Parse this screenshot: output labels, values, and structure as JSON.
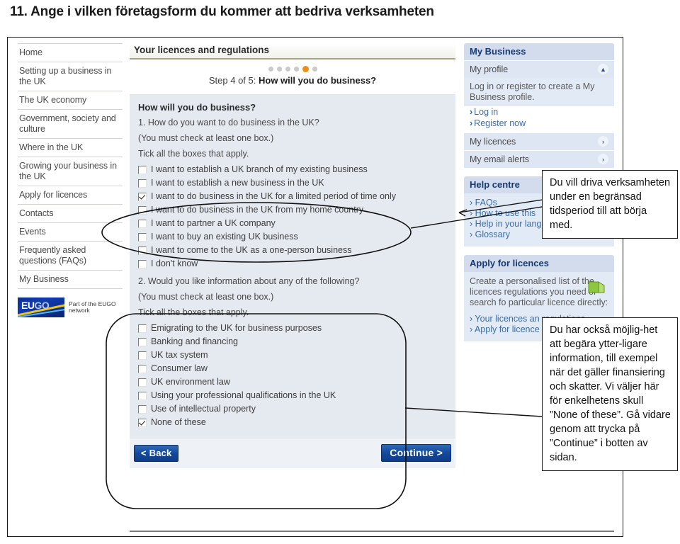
{
  "slide": {
    "heading": "11. Ange i vilken företagsform du kommer att bedriva verksamheten"
  },
  "sidebar": {
    "items": [
      {
        "label": "Home"
      },
      {
        "label": "Setting up a business in the UK"
      },
      {
        "label": "The UK economy"
      },
      {
        "label": "Government, society and culture"
      },
      {
        "label": "Where in the UK"
      },
      {
        "label": "Growing your business in the UK"
      },
      {
        "label": "Apply for licences"
      },
      {
        "label": "Contacts"
      },
      {
        "label": "Events"
      },
      {
        "label": "Frequently asked questions (FAQs)"
      },
      {
        "label": "My Business"
      }
    ],
    "logo": {
      "badge_eu": "EU",
      "badge_go": "GO",
      "tagline": "Part of\nthe EUGO\nnetwork"
    }
  },
  "main": {
    "title": "Your licences and regulations",
    "step": {
      "prefix": "Step 4 of 5: ",
      "title": "How will you do business?",
      "dots_total": 6,
      "active_dot": 5,
      "active_color": "#f28c14",
      "inactive_color": "#c9c9c9"
    },
    "form": {
      "heading": "How will you do business?",
      "q1": {
        "question": "1. How do you want to do business in the UK?",
        "requirement": "(You must check at least one box.)",
        "instruction": "Tick all the boxes that apply.",
        "options": [
          {
            "label": "I want to establish a UK branch of my existing business",
            "checked": false
          },
          {
            "label": "I want to establish a new business in the UK",
            "checked": false
          },
          {
            "label": "I want to do business in the UK for a limited period of time only",
            "checked": true
          },
          {
            "label": "I want to do business in the UK from my home country",
            "checked": false
          },
          {
            "label": "I want to partner a UK company",
            "checked": false
          },
          {
            "label": "I want to buy an existing UK business",
            "checked": false
          },
          {
            "label": "I want to come to the UK as a one-person business",
            "checked": false
          },
          {
            "label": "I don't know",
            "checked": false
          }
        ]
      },
      "q2": {
        "question": "2. Would you like information about any of the following?",
        "requirement": "(You must check at least one box.)",
        "instruction": "Tick all the boxes that apply.",
        "options": [
          {
            "label": "Emigrating to the UK for business purposes",
            "checked": false
          },
          {
            "label": "Banking and financing",
            "checked": false
          },
          {
            "label": "UK tax system",
            "checked": false
          },
          {
            "label": "Consumer law",
            "checked": false
          },
          {
            "label": "UK environment law",
            "checked": false
          },
          {
            "label": "Using your professional qualifications in the UK",
            "checked": false
          },
          {
            "label": "Use of intellectual property",
            "checked": false
          },
          {
            "label": "None of these",
            "checked": true
          }
        ]
      }
    },
    "buttons": {
      "back": "< Back",
      "continue": "Continue >"
    }
  },
  "right_col": {
    "my_business": {
      "title": "My Business",
      "profile_row": "My profile",
      "profile_chevron": "chevron-up-icon",
      "profile_text": "Log in or register to create a My Business profile.",
      "profile_links": [
        "Log in",
        "Register now"
      ],
      "rows": [
        {
          "label": "My licences",
          "chevron": "chevron-right-icon"
        },
        {
          "label": "My email alerts",
          "chevron": "chevron-right-icon"
        }
      ]
    },
    "help_centre": {
      "title": "Help centre",
      "links": [
        "FAQs",
        "How to use this",
        "Help in your language",
        "Glossary"
      ]
    },
    "apply_licences": {
      "title": "Apply for licences",
      "text": "Create a personalised list of the licences regulations you need or search fo particular licence directly:",
      "links": [
        "Your licences an regulations",
        "Apply for licence"
      ]
    }
  },
  "annotations": {
    "callout_top": "Du vill driva verksamheten under en begränsad tidsperiod till att börja med.",
    "callout_bottom": "Du har också möjlig-het att begära ytter-ligare information, till exempel när det gäller finansiering och skatter. Vi väljer här för enkelhetens skull ”None of these”. Gå vidare genom att trycka på ”Continue” i botten av sidan."
  }
}
